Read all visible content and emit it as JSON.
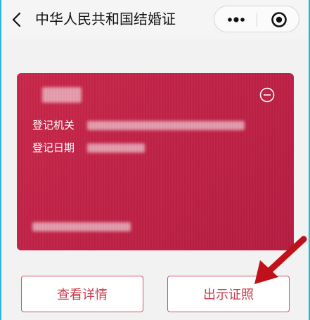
{
  "navbar": {
    "title": "中华人民共和国结婚证"
  },
  "card": {
    "label_registrar": "登记机关",
    "label_date": "登记日期"
  },
  "actions": {
    "view_details": "查看详情",
    "show_certificate": "出示证照"
  },
  "colors": {
    "card_red": "#c12446",
    "button_text": "#c83a4b",
    "arrow": "#c0101a"
  },
  "icons": [
    "back-chevron-icon",
    "more-dots-icon",
    "target-icon",
    "collapse-minus-icon",
    "arrow-annotation-icon"
  ]
}
